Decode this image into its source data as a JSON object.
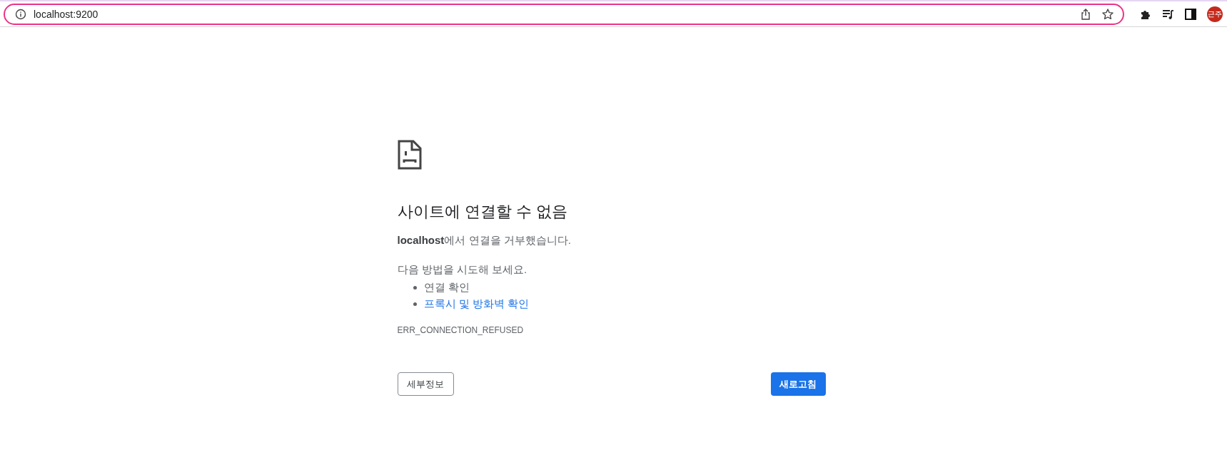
{
  "address_bar": {
    "url": "localhost:9200"
  },
  "profile": {
    "initials": "근주"
  },
  "error_page": {
    "title": "사이트에 연결할 수 없음",
    "message": "**localhost**에서 연결을 거부했습니다.",
    "suggestions_heading": "다음 방법을 시도해 보세요.",
    "suggestions": [
      {
        "text": "연결 확인",
        "kind": "plain"
      },
      {
        "text": "프록시 및 방화벽 확인",
        "kind": "link"
      }
    ],
    "error_code": "ERR_CONNECTION_REFUSED",
    "details_button": "세부정보",
    "reload_button": "새로고침"
  }
}
